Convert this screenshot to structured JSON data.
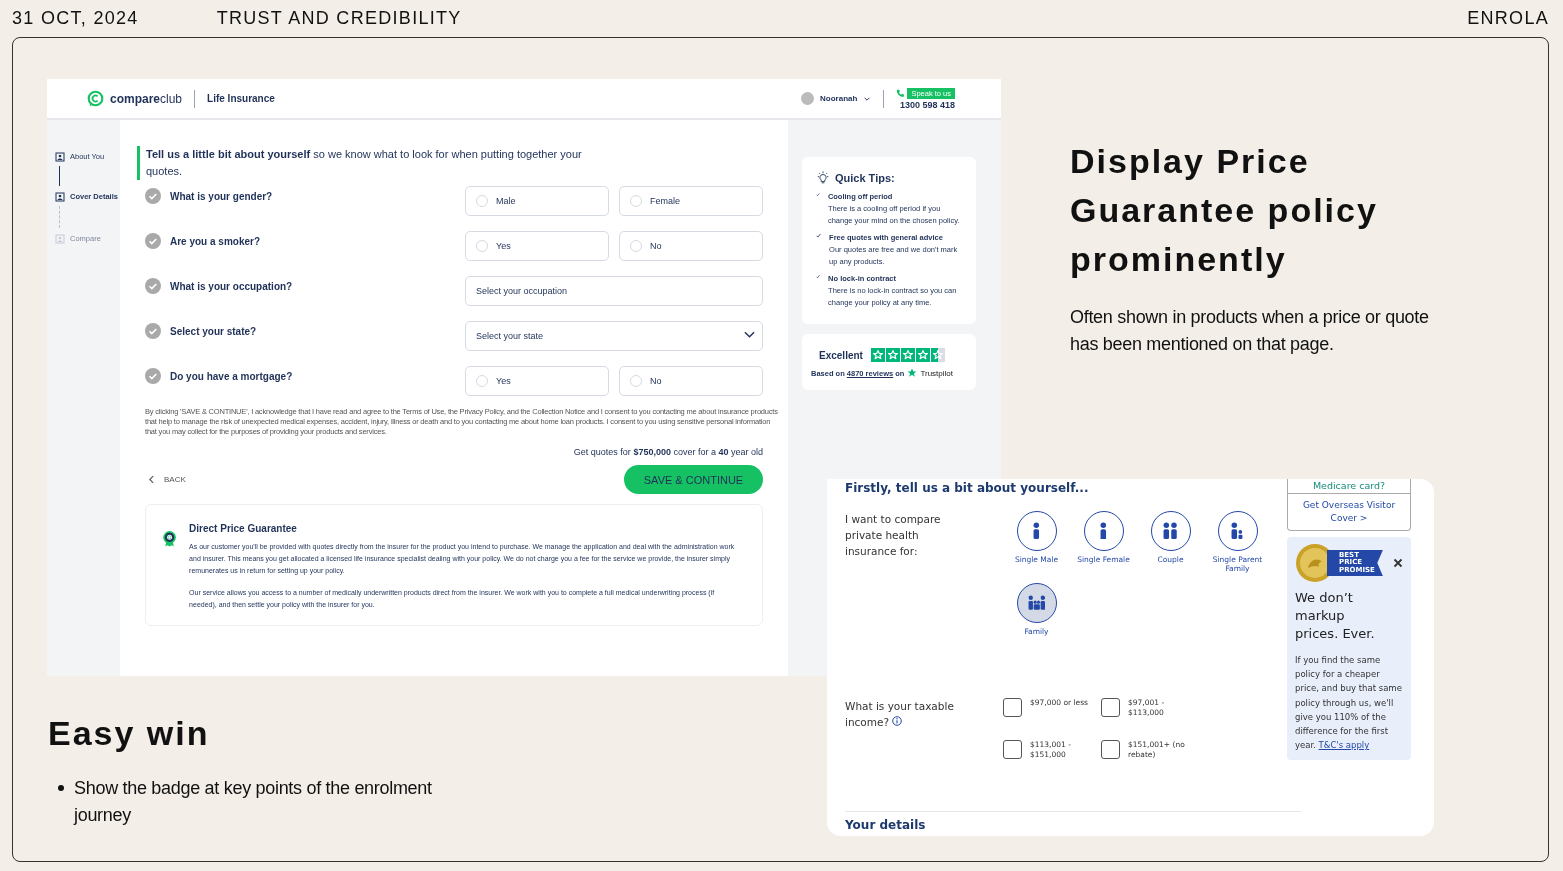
{
  "slide": {
    "date": "31 OCT, 2024",
    "title": "TRUST AND CREDIBILITY",
    "brand": "ENROLA"
  },
  "life_insurance_screen": {
    "header": {
      "logo": "**compare**club",
      "product": "Life Insurance",
      "user": "Nooranah",
      "call_badge": "Speak to us",
      "phone": "1300 598 418"
    },
    "steps": [
      {
        "label": "About You",
        "selected": false,
        "disabled": false
      },
      {
        "label": "Cover Details",
        "selected": true,
        "disabled": false
      },
      {
        "label": "Compare",
        "selected": false,
        "disabled": true
      }
    ],
    "intro": "**Tell us a little bit about yourself** so we know what to look for when putting together your quotes.",
    "questions": [
      {
        "label": "What is your gender?",
        "kind": "radio",
        "options": [
          {
            "label": "Male",
            "selected": false
          },
          {
            "label": "Female",
            "selected": false
          }
        ]
      },
      {
        "label": "Are you a smoker?",
        "kind": "radio",
        "options": [
          {
            "label": "Yes",
            "selected": false
          },
          {
            "label": "No",
            "selected": false
          }
        ]
      },
      {
        "label": "What is your occupation?",
        "kind": "search",
        "placeholder": "Select your occupation"
      },
      {
        "label": "Select your state?",
        "kind": "dropdown",
        "placeholder": "Select your state"
      },
      {
        "label": "Do you have a mortgage?",
        "kind": "radio",
        "options": [
          {
            "label": "Yes",
            "selected": false
          },
          {
            "label": "No",
            "selected": false
          }
        ]
      }
    ],
    "disclaimer": "By clicking 'SAVE & CONTINUE', I acknowledge that I have read and agree to the Terms of Use, the Privacy Policy, and the Collection Notice and I consent to you contacting me about insurance products that help to manage the risk of unexpected medical expenses, accident, injury, illness or death and to you contacting me about home loan products. I consent to you using sensitive personal information that you may collect for the purposes of providing your products and services.",
    "quote_summary": "Get quotes for **$750,000** cover for a **40** year old",
    "back": "BACK",
    "continue": "SAVE & CONTINUE",
    "guarantee": {
      "title": "Direct Price Guarantee",
      "paragraphs": [
        "As our customer you'll be provided with quotes directly from the insurer for the product you intend to purchase. We manage the application and deal with the administration work and insurer. This means you get allocated a licensed life insurance specialist dealing with your policy. We do not charge you a fee for the service we provide, the insurer simply remunerates us in return for setting up your policy.",
        "Our service allows you access to a number of medically underwritten products direct from the insurer. We work with you to complete a full medical underwriting process (if needed), and then settle your policy with the insurer for you."
      ]
    },
    "tips": {
      "title": "Quick Tips:",
      "items": [
        {
          "title": "Cooling off period",
          "text": "There is a cooling off period if you change your mind on the chosen policy."
        },
        {
          "title": "Free quotes with general advice",
          "text": "Our quotes are free and we don't mark up any products."
        },
        {
          "title": "No lock-in contract",
          "text": "There is no lock-in contract so you can change your policy at any time."
        }
      ]
    },
    "rating": {
      "label": "Excellent",
      "stars": 4.5,
      "based_on": "Based on",
      "reviews_link": "4870 reviews",
      "on": "on",
      "platform": "Trustpilot"
    }
  },
  "callout": {
    "heading": "Display Price Guarantee policy prominently",
    "text": "Often shown in products when a price or quote has been mentioned on that page."
  },
  "easy_win": {
    "heading": "Easy win",
    "bullets": [
      "Show the badge at key points of the enrolment journey"
    ]
  },
  "health_screen": {
    "section_heading": "Firstly, tell us a bit about yourself...",
    "cover_for": {
      "label": "I want to compare private health insurance for:",
      "options": [
        {
          "label": "Single Male",
          "kind": "male",
          "selected": false
        },
        {
          "label": "Single Female",
          "kind": "female",
          "selected": false
        },
        {
          "label": "Couple",
          "kind": "couple",
          "selected": false
        },
        {
          "label": "Single Parent Family",
          "kind": "parent",
          "selected": false
        },
        {
          "label": "Family",
          "kind": "family",
          "selected": true
        }
      ]
    },
    "income": {
      "label": "What is your taxable income?",
      "options": [
        {
          "label": "$97,000 or less",
          "checked": false
        },
        {
          "label": "$97,001 - $113,000",
          "checked": false
        },
        {
          "label": "$113,001 - $151,000",
          "checked": false
        },
        {
          "label": "$151,001+ (no rebate)",
          "checked": false
        }
      ]
    },
    "next_heading": "Your details",
    "side": {
      "medicare": "Medicare card?",
      "overseas_link": "Get Overseas Visitor Cover >",
      "promo": {
        "ribbon_lines": [
          "BEST",
          "PRICE",
          "PROMISE"
        ],
        "headline": "We don’t markup prices. Ever.",
        "body": "If you find the same policy for a cheaper price, and buy that same policy through us, we'll give you 110% of the difference for the first year.",
        "link": "T&C's apply"
      }
    }
  }
}
